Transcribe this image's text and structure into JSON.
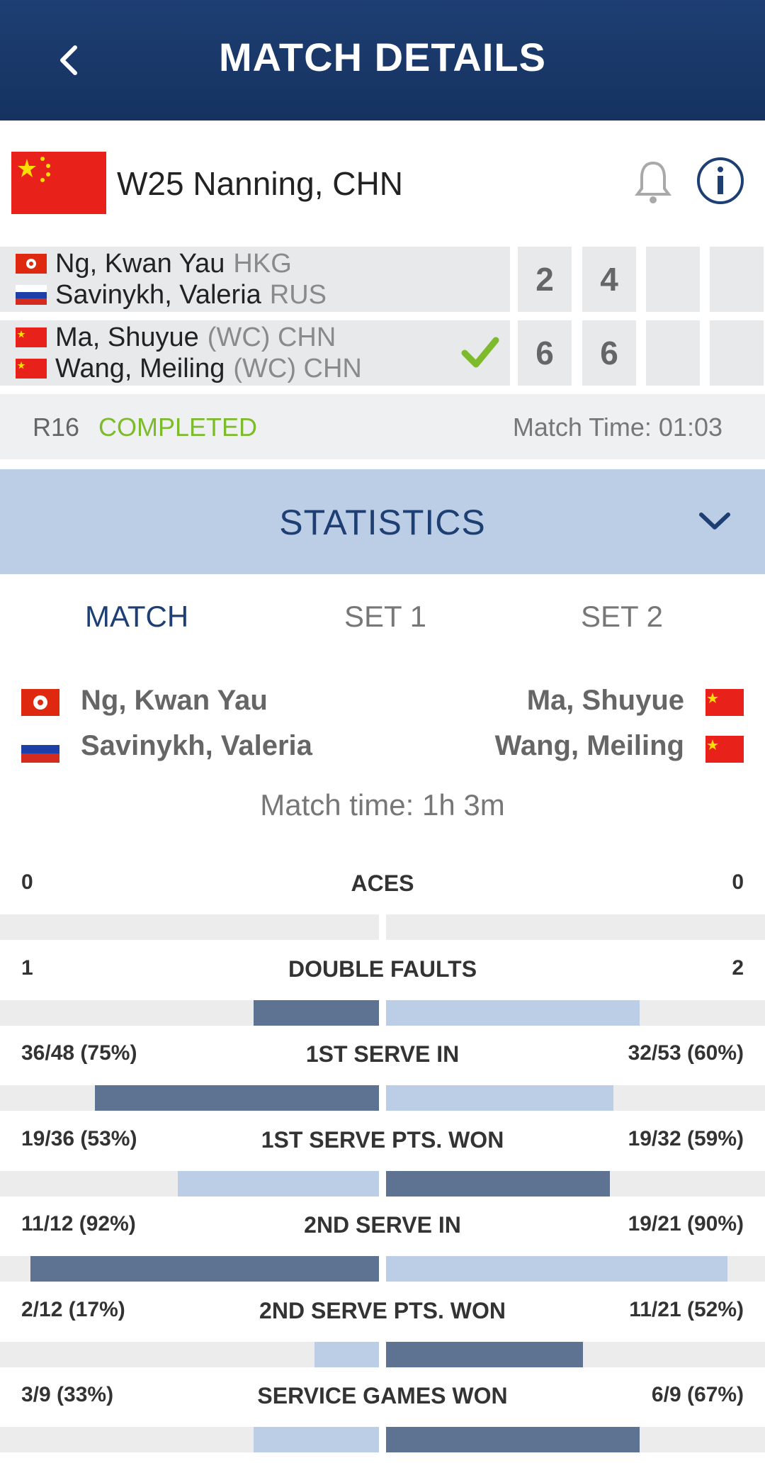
{
  "header": {
    "title": "MATCH DETAILS",
    "back_icon": "chevron-left-icon"
  },
  "tournament": {
    "name": "W25 Nanning, CHN",
    "flag": "china-flag",
    "bell_icon": "bell-icon",
    "info_icon": "info-icon"
  },
  "teams": [
    {
      "players": [
        {
          "name": "Ng, Kwan Yau",
          "nat": "HKG",
          "flag": "hong-kong-flag"
        },
        {
          "name": "Savinykh, Valeria",
          "nat": "RUS",
          "flag": "russia-flag"
        }
      ],
      "sets": [
        "2",
        "4",
        "",
        ""
      ],
      "winner": false
    },
    {
      "players": [
        {
          "name": "Ma, Shuyue",
          "nat": "(WC) CHN",
          "flag": "china-flag"
        },
        {
          "name": "Wang, Meiling",
          "nat": "(WC) CHN",
          "flag": "china-flag"
        }
      ],
      "sets": [
        "6",
        "6",
        "",
        ""
      ],
      "winner": true
    }
  ],
  "status": {
    "round": "R16",
    "state": "COMPLETED",
    "match_time": "Match Time: 01:03"
  },
  "statistics": {
    "label": "STATISTICS"
  },
  "tabs": [
    "MATCH",
    "SET 1",
    "SET 2"
  ],
  "compare": {
    "left": [
      "Ng, Kwan Yau",
      "Savinykh, Valeria"
    ],
    "right": [
      "Ma, Shuyue",
      "Wang, Meiling"
    ],
    "match_time": "Match time: 1h 3m"
  },
  "stats": [
    {
      "name": "ACES",
      "left": "0",
      "right": "0",
      "lf": 0,
      "rf": 0,
      "lead": "none"
    },
    {
      "name": "DOUBLE FAULTS",
      "left": "1",
      "right": "2",
      "lf": 0.33,
      "rf": 0.67,
      "lead": "left"
    },
    {
      "name": "1ST SERVE IN",
      "left": "36/48 (75%)",
      "right": "32/53 (60%)",
      "lf": 0.75,
      "rf": 0.6,
      "lead": "left"
    },
    {
      "name": "1ST SERVE PTS. WON",
      "left": "19/36 (53%)",
      "right": "19/32 (59%)",
      "lf": 0.53,
      "rf": 0.59,
      "lead": "right"
    },
    {
      "name": "2ND SERVE IN",
      "left": "11/12 (92%)",
      "right": "19/21 (90%)",
      "lf": 0.92,
      "rf": 0.9,
      "lead": "left"
    },
    {
      "name": "2ND SERVE PTS. WON",
      "left": "2/12 (17%)",
      "right": "11/21 (52%)",
      "lf": 0.17,
      "rf": 0.52,
      "lead": "right"
    },
    {
      "name": "SERVICE GAMES WON",
      "left": "3/9 (33%)",
      "right": "6/9 (67%)",
      "lf": 0.33,
      "rf": 0.67,
      "lead": "right"
    }
  ],
  "colors": {
    "accent": "#1e3f73",
    "completed": "#7dbb2d",
    "bar_dark": "#5e7391",
    "bar_light": "#bccde6"
  }
}
